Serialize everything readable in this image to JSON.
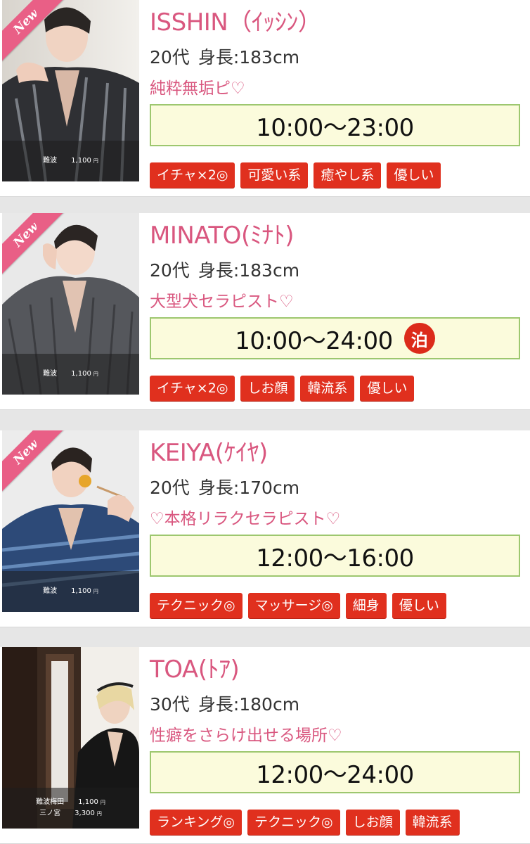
{
  "therapists": [
    {
      "name": "ISSHIN（ｲｯｼﾝ）",
      "is_new": true,
      "new_label": "New",
      "age": "20代",
      "height": "身長:183cm",
      "catch": "純粋無垢ピ♡",
      "schedule": "10:00〜23:00",
      "stay": false,
      "prices": [
        {
          "area": "難波",
          "amount": "1,100",
          "unit": "円"
        }
      ],
      "tags": [
        "イチャ×2◎",
        "可愛い系",
        "癒やし系",
        "優しい"
      ],
      "photo_theme": "striped-black-yukata"
    },
    {
      "name": "MINATO(ﾐﾅﾄ)",
      "is_new": true,
      "new_label": "New",
      "age": "20代",
      "height": "身長:183cm",
      "catch": "大型犬セラピスト♡",
      "schedule": "10:00〜24:00",
      "stay": true,
      "stay_label": "泊",
      "prices": [
        {
          "area": "難波",
          "amount": "1,100",
          "unit": "円"
        }
      ],
      "tags": [
        "イチャ×2◎",
        "しお顔",
        "韓流系",
        "優しい"
      ],
      "photo_theme": "grey-yukata"
    },
    {
      "name": "KEIYA(ｹｲﾔ)",
      "is_new": true,
      "new_label": "New",
      "age": "20代",
      "height": "身長:170cm",
      "catch": "♡本格リラクセラピスト♡",
      "schedule": "12:00〜16:00",
      "stay": false,
      "prices": [
        {
          "area": "難波",
          "amount": "1,100",
          "unit": "円"
        }
      ],
      "tags": [
        "テクニック◎",
        "マッサージ◎",
        "細身",
        "優しい"
      ],
      "photo_theme": "blue-yukata"
    },
    {
      "name": "TOA(ﾄｱ)",
      "is_new": false,
      "age": "30代",
      "height": "身長:180cm",
      "catch": "性癖をさらけ出せる場所♡",
      "schedule": "12:00〜24:00",
      "stay": false,
      "prices": [
        {
          "area": "難波梅田",
          "amount": "1,100",
          "unit": "円"
        },
        {
          "area": "三ノ宮",
          "amount": "3,300",
          "unit": "円"
        }
      ],
      "tags": [
        "ランキング◎",
        "テクニック◎",
        "しお顔",
        "韓流系"
      ],
      "photo_theme": "dark-room-black-kimono"
    }
  ],
  "colors": {
    "name_pink": "#d9577f",
    "tag_red": "#e0301e",
    "schedule_bg": "#fbfbdc",
    "schedule_border": "#9dc76f",
    "ribbon_pink": "#e95f86",
    "stay_red": "#dc2b1a"
  }
}
